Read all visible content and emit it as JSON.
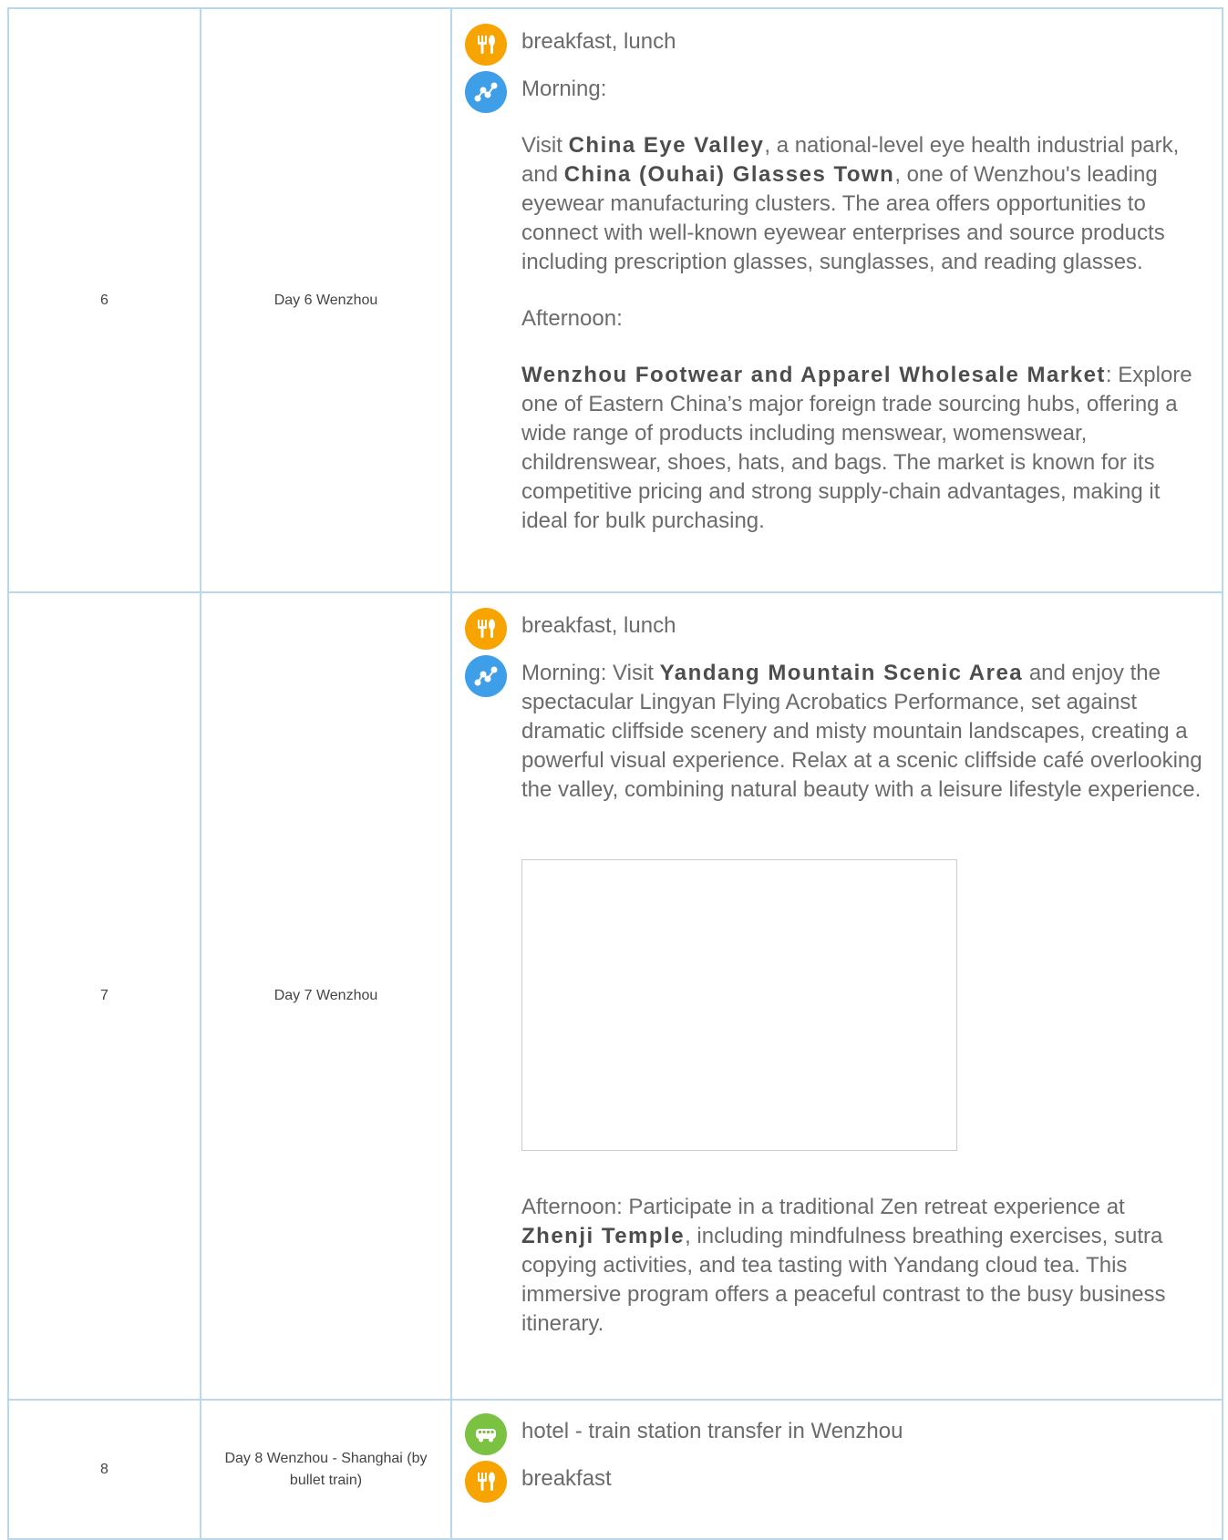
{
  "rows": [
    {
      "num": "6",
      "day": "Day 6 Wenzhou",
      "meals": "breakfast, lunch",
      "morning_label": "Morning:",
      "morning_p1_a": "Visit ",
      "morning_b1": "China Eye Valley",
      "morning_p1_b": ", a national-level eye health industrial park, and ",
      "morning_b2": "China (Ouhai) Glasses Town",
      "morning_p1_c": ", one of Wenzhou's leading eyewear manufacturing clusters. The area offers opportunities to connect with well-known eyewear enterprises and source products including prescription glasses, sunglasses, and reading glasses.",
      "afternoon_label": "Afternoon:",
      "afternoon_b": "Wenzhou Footwear and Apparel Wholesale Market",
      "afternoon_text": ": Explore one of Eastern China’s major foreign trade sourcing hubs, offering a wide range of products including menswear, womenswear, childrenswear, shoes, hats, and bags. The market is known for its competitive pricing and strong supply-chain advantages, making it ideal for bulk purchasing."
    },
    {
      "num": "7",
      "day": "Day 7 Wenzhou",
      "meals": "breakfast, lunch",
      "morning_a": "Morning: Visit ",
      "morning_b": "Yandang Mountain Scenic Area",
      "morning_c": " and enjoy the spectacular Lingyan Flying Acrobatics Performance, set against dramatic cliffside scenery and misty mountain landscapes, creating a powerful visual experience. Relax at a scenic cliffside café overlooking the valley, combining natural beauty with a leisure lifestyle experience.",
      "afternoon_a": "Afternoon: Participate in a traditional Zen retreat experience at ",
      "afternoon_b": "Zhenji Temple",
      "afternoon_c": ", including mindfulness breathing exercises, sutra copying activities, and tea tasting with Yandang cloud tea. This immersive program offers a peaceful contrast to the busy business itinerary."
    },
    {
      "num": "8",
      "day": "Day 8 Wenzhou - Shanghai (by bullet train)",
      "transfer": "hotel - train station transfer in Wenzhou",
      "meals": "breakfast"
    }
  ],
  "icons": {
    "meal": "meal-icon",
    "route": "route-icon",
    "transfer": "bus-icon"
  },
  "colors": {
    "border": "#b9d8ec",
    "meal": "#f7a400",
    "route": "#3e9ee8",
    "transfer": "#7cc242"
  }
}
